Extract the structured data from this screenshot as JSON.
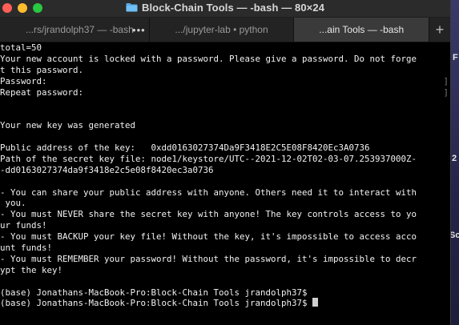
{
  "window": {
    "title": "Block-Chain Tools — -bash — 80×24"
  },
  "tabs": [
    {
      "label": "...rs/jrandolph37 — -bash",
      "active": false
    },
    {
      "label": ".../jupyter-lab • python",
      "active": false
    },
    {
      "label": "...ain Tools — -bash",
      "active": true
    }
  ],
  "tab_overflow_label": "•••",
  "new_tab_label": "+",
  "terminal_lines": [
    "total=50",
    "Your new account is locked with a password. Please give a password. Do not forge",
    "t this password.",
    "Password:",
    "Repeat password:",
    "",
    "",
    "Your new key was generated",
    "",
    "Public address of the key:   0xdd0163027374Da9F3418E2C5E08F8420Ec3A0736",
    "Path of the secret key file: node1/keystore/UTC--2021-12-02T02-03-07.253937000Z-",
    "-dd0163027374da9f3418e2c5e08f8420ec3a0736",
    "",
    "- You can share your public address with anyone. Others need it to interact with",
    " you.",
    "- You must NEVER share the secret key with anyone! The key controls access to yo",
    "ur funds!",
    "- You must BACKUP your key file! Without the key, it's impossible to access acco",
    "unt funds!",
    "- You must REMEMBER your password! Without the password, it's impossible to decr",
    "ypt the key!",
    "",
    "(base) Jonathans-MacBook-Pro:Block-Chain Tools jrandolph37$",
    "(base) Jonathans-MacBook-Pro:Block-Chain Tools jrandolph37$ "
  ],
  "desktop_fragments": {
    "a": "F",
    "b": "2",
    "c": "Sc"
  }
}
